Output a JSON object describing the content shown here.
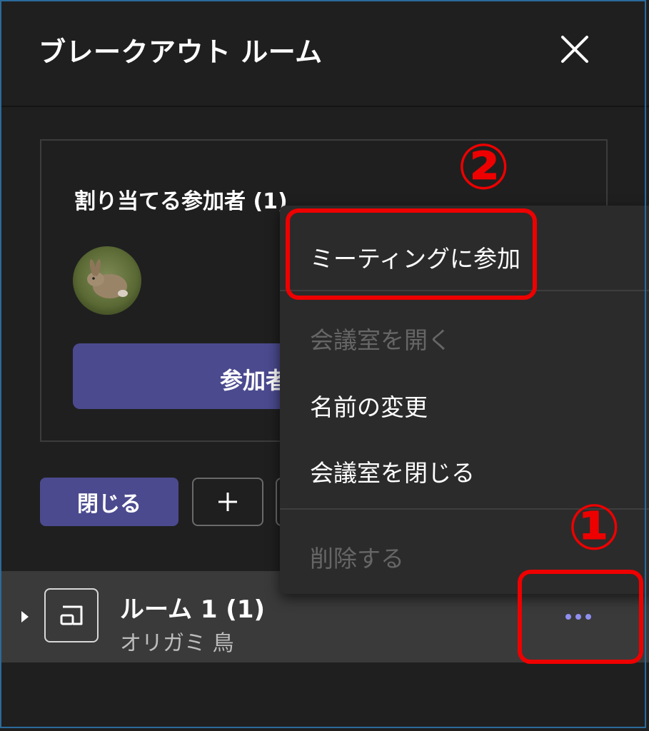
{
  "header": {
    "title": "ブレークアウト ルーム",
    "close_icon": "close-icon"
  },
  "assign": {
    "title": "割り当てる参加者 (1)",
    "button_label": "参加者",
    "avatar_alt": "rabbit-avatar"
  },
  "actions": {
    "close_label": "閉じる",
    "add_icon": "plus-icon"
  },
  "room": {
    "name": "ルーム 1 (1)",
    "member": "オリガミ 鳥",
    "icon": "room-icon",
    "more_icon": "more-icon"
  },
  "menu": {
    "items": [
      {
        "label": "ミーティングに参加",
        "enabled": true
      },
      {
        "label": "会議室を開く",
        "enabled": false
      },
      {
        "label": "名前の変更",
        "enabled": true
      },
      {
        "label": "会議室を閉じる",
        "enabled": true
      },
      {
        "label": "削除する",
        "enabled": false
      }
    ]
  },
  "annotations": {
    "marker1": "①",
    "marker2": "②"
  },
  "colors": {
    "accent": "#4b4a8f",
    "highlight": "#ee0000",
    "more_dots": "#8f8ff0"
  }
}
